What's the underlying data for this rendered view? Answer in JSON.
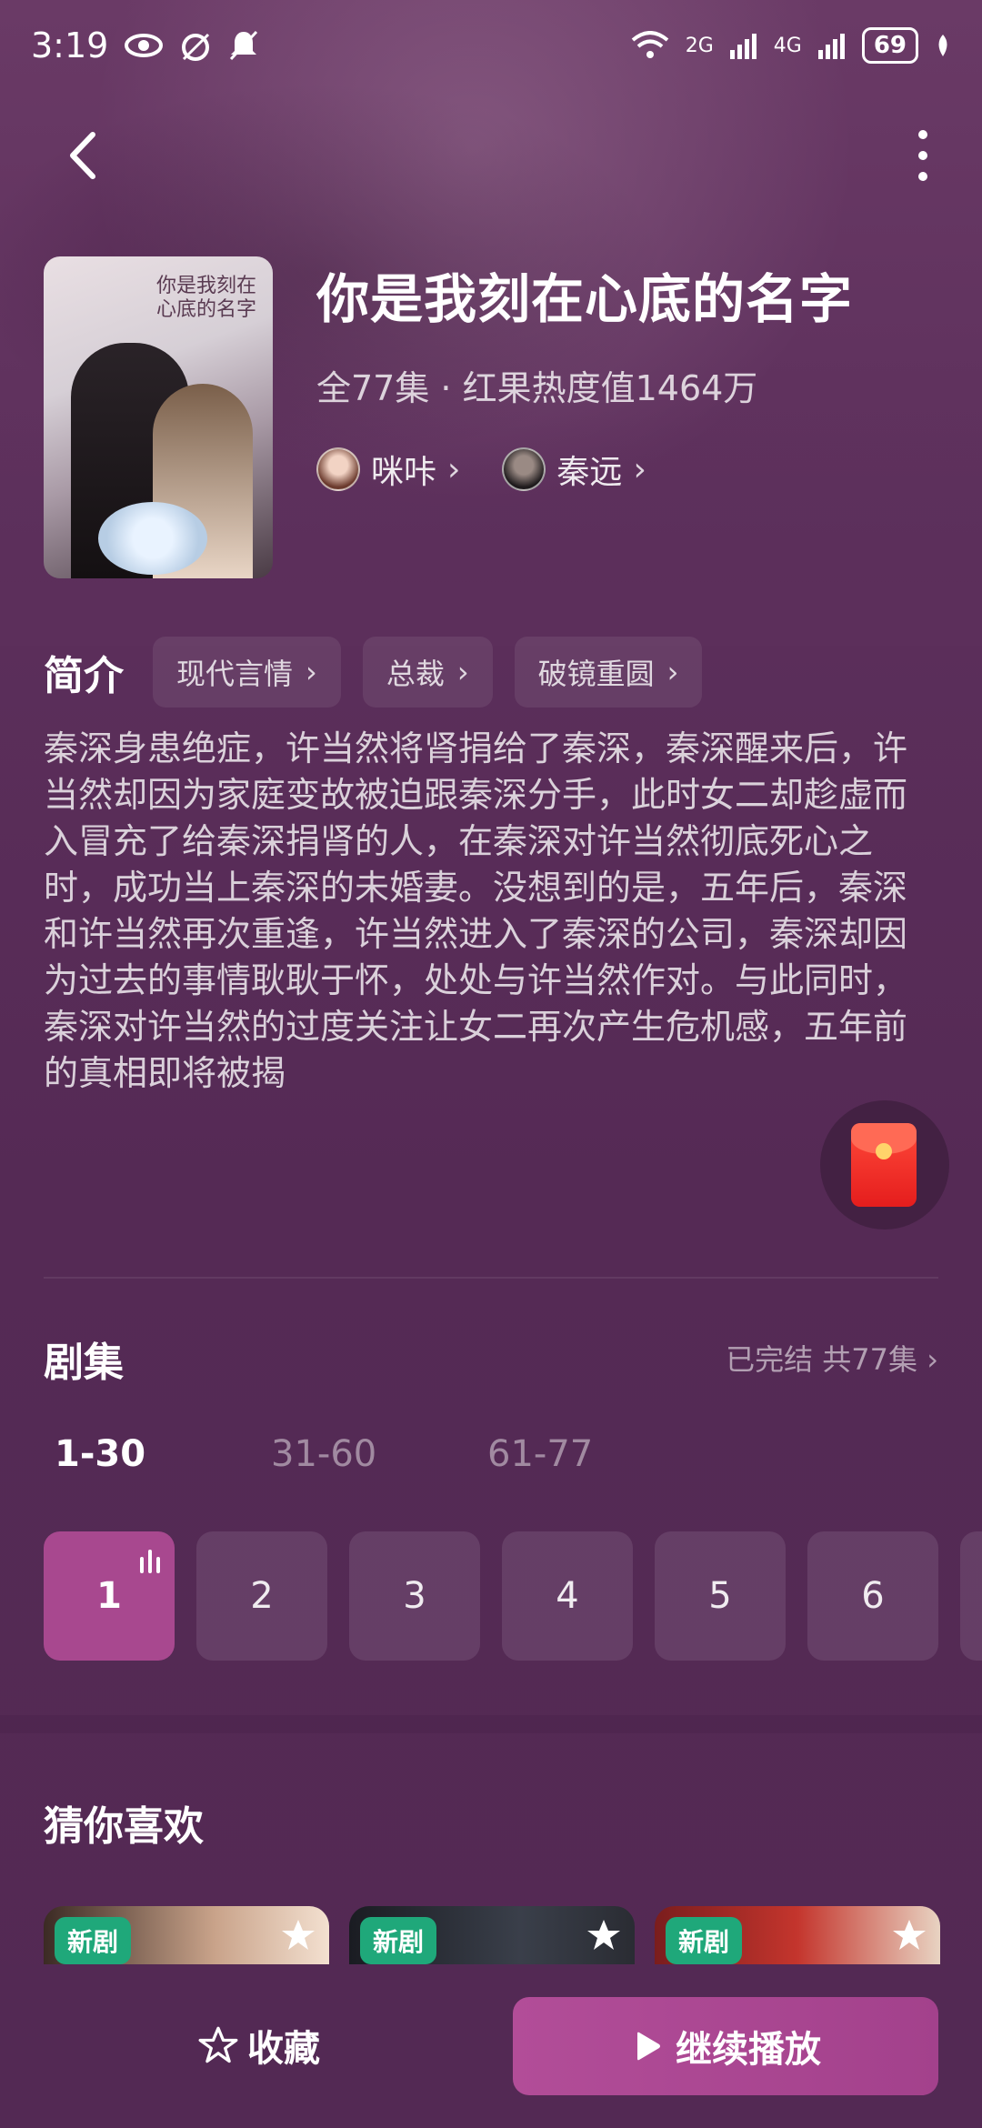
{
  "status_bar": {
    "time": "3:19",
    "network1": "2G",
    "network2": "4G",
    "battery": "69"
  },
  "drama": {
    "poster_title": "你是我刻在心底的名字",
    "title": "你是我刻在心底的名字",
    "meta": "全77集 · 红果热度值1464万",
    "cast": [
      {
        "name": "咪咔",
        "icon": "avatar"
      },
      {
        "name": "秦远",
        "icon": "avatar"
      }
    ]
  },
  "intro": {
    "label": "简介",
    "tags": [
      "现代言情",
      "总裁",
      "破镜重圆"
    ],
    "synopsis": "秦深身患绝症，许当然将肾捐给了秦深，秦深醒来后，许当然却因为家庭变故被迫跟秦深分手，此时女二却趁虚而入冒充了给秦深捐肾的人，在秦深对许当然彻底死心之时，成功当上秦深的未婚妻。没想到的是，五年后，秦深和许当然再次重逢，许当然进入了秦深的公司，秦深却因为过去的事情耿耿于怀，处处与许当然作对。与此同时，秦深对许当然的过度关注让女二再次产生危机感，五年前的真相即将被揭"
  },
  "episodes": {
    "title": "剧集",
    "status": "已完结 共77集",
    "ranges": [
      "1-30",
      "31-60",
      "61-77"
    ],
    "active_range": "1-30",
    "items": [
      "1",
      "2",
      "3",
      "4",
      "5",
      "6"
    ],
    "playing": "1"
  },
  "recommend": {
    "title": "猜你喜欢",
    "cards": [
      {
        "badge": "新剧"
      },
      {
        "badge": "新剧"
      },
      {
        "badge": "新剧"
      }
    ]
  },
  "bottom": {
    "favorite_label": "收藏",
    "play_label": "继续播放"
  },
  "colors": {
    "accent": "#a8488f",
    "badge_new": "#1fa87a",
    "bg": "#5c2f5b"
  }
}
